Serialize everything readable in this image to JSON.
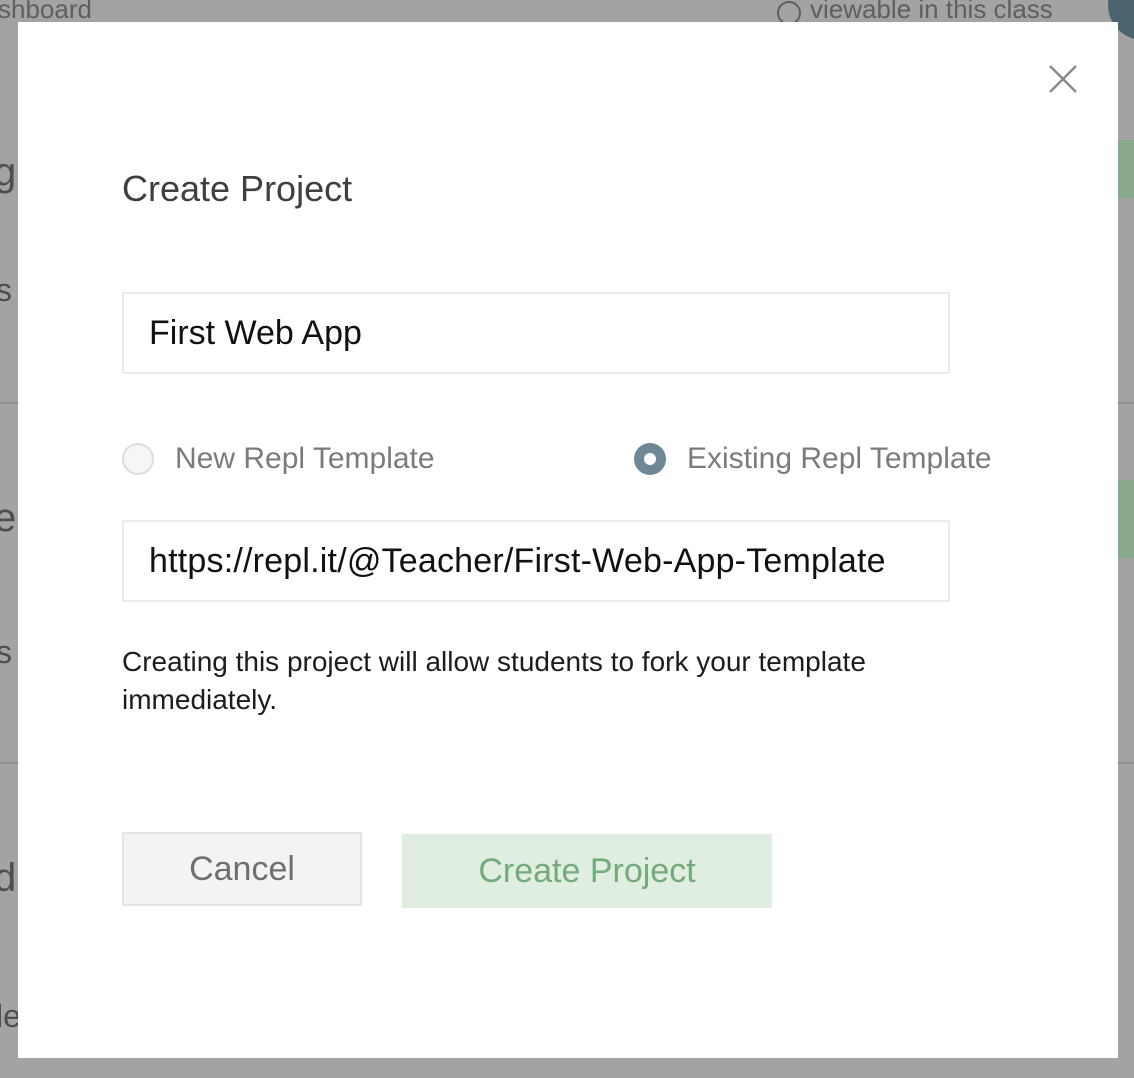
{
  "background": {
    "dashboard_label": "shboard",
    "viewable_label": "viewable in this class"
  },
  "modal": {
    "title": "Create Project",
    "close_icon": "close-icon",
    "project_name_value": "First Web App",
    "template_options": {
      "new_label": "New Repl Template",
      "existing_label": "Existing Repl Template",
      "selected": "existing"
    },
    "template_url_value": "https://repl.it/@Teacher/First-Web-App-Template",
    "hint": "Creating this project will allow students to fork your template immediately.",
    "cancel_label": "Cancel",
    "create_label": "Create Project"
  },
  "colors": {
    "radio_selected": "#6d8896",
    "create_button_bg": "#dfeee0",
    "create_button_text": "#74aa7c"
  }
}
